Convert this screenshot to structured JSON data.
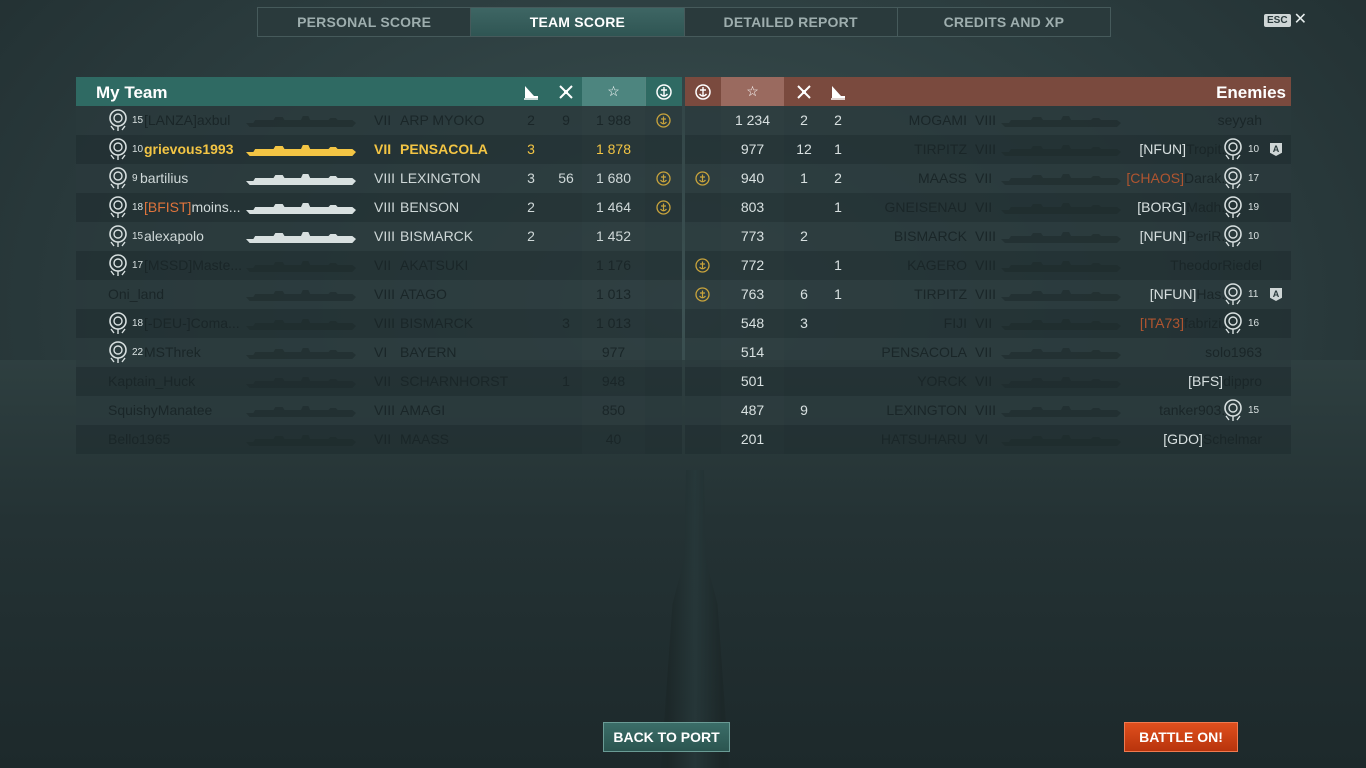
{
  "tabs": [
    {
      "label": "PERSONAL SCORE",
      "active": false
    },
    {
      "label": "TEAM SCORE",
      "active": true
    },
    {
      "label": "DETAILED REPORT",
      "active": false
    },
    {
      "label": "CREDITS AND XP",
      "active": false
    }
  ],
  "close": {
    "key_label": "ESC",
    "icon": "close-icon"
  },
  "my_team": {
    "title": "My Team",
    "header_icons": [
      "ship-destroyed-icon",
      "planes-destroyed-icon",
      "base-xp-star-icon",
      "achievement-icon"
    ],
    "rows": [
      {
        "rank": "15",
        "clan": "[LANZA]",
        "clan_orange": false,
        "name": "axbul",
        "tier": "VII",
        "ship": "ARP MYOKO",
        "kills": "2",
        "planes": "9",
        "xp": "1 988",
        "achievement": true,
        "state": "dead"
      },
      {
        "rank": "10",
        "clan": "",
        "clan_orange": false,
        "name": "grievous1993",
        "tier": "VII",
        "ship": "PENSACOLA",
        "kills": "3",
        "planes": "",
        "xp": "1 878",
        "achievement": false,
        "state": "me"
      },
      {
        "rank": "9",
        "clan": "",
        "clan_orange": false,
        "name": "bartilius",
        "tier": "VIII",
        "ship": "LEXINGTON",
        "kills": "3",
        "planes": "56",
        "xp": "1 680",
        "achievement": true,
        "state": "alive"
      },
      {
        "rank": "18",
        "clan": "[BFIST]",
        "clan_orange": true,
        "name": "moins...",
        "tier": "VIII",
        "ship": "BENSON",
        "kills": "2",
        "planes": "",
        "xp": "1 464",
        "achievement": true,
        "state": "alive"
      },
      {
        "rank": "15",
        "clan": "",
        "clan_orange": false,
        "name": "alexapolo",
        "tier": "VIII",
        "ship": "BISMARCK",
        "kills": "2",
        "planes": "",
        "xp": "1 452",
        "achievement": false,
        "state": "alive"
      },
      {
        "rank": "17",
        "clan": "[MSSD]",
        "clan_orange": false,
        "name": "Maste...",
        "tier": "VII",
        "ship": "AKATSUKI",
        "kills": "",
        "planes": "",
        "xp": "1 176",
        "achievement": false,
        "state": "dead"
      },
      {
        "rank": "",
        "clan": "",
        "clan_orange": false,
        "name": "Oni_land",
        "tier": "VIII",
        "ship": "ATAGO",
        "kills": "",
        "planes": "",
        "xp": "1 013",
        "achievement": false,
        "state": "dead"
      },
      {
        "rank": "18",
        "clan": "[-DEU-]",
        "clan_orange": false,
        "name": "Coma...",
        "tier": "VIII",
        "ship": "BISMARCK",
        "kills": "",
        "planes": "3",
        "xp": "1 013",
        "achievement": false,
        "state": "dead"
      },
      {
        "rank": "22",
        "clan": "",
        "clan_orange": false,
        "name": "MSThrek",
        "tier": "VI",
        "ship": "BAYERN",
        "kills": "",
        "planes": "",
        "xp": "977",
        "achievement": false,
        "state": "dead"
      },
      {
        "rank": "",
        "clan": "",
        "clan_orange": false,
        "name": "Kaptain_Huck",
        "tier": "VII",
        "ship": "SCHARNHORST",
        "kills": "",
        "planes": "1",
        "xp": "948",
        "achievement": false,
        "state": "dead"
      },
      {
        "rank": "",
        "clan": "",
        "clan_orange": false,
        "name": "SquishyManatee",
        "tier": "VIII",
        "ship": "AMAGI",
        "kills": "",
        "planes": "",
        "xp": "850",
        "achievement": false,
        "state": "dead"
      },
      {
        "rank": "",
        "clan": "",
        "clan_orange": false,
        "name": "Bello1965",
        "tier": "VII",
        "ship": "MAASS",
        "kills": "",
        "planes": "",
        "xp": "40",
        "achievement": false,
        "state": "dead"
      }
    ]
  },
  "enemies": {
    "title": "Enemies",
    "header_icons": [
      "achievement-icon",
      "base-xp-star-icon",
      "planes-destroyed-icon",
      "ship-destroyed-icon"
    ],
    "rows": [
      {
        "achievement": false,
        "xp": "1 234",
        "planes": "2",
        "kills": "2",
        "ship": "MOGAMI",
        "tier": "VIII",
        "clan": "",
        "clan_orange": false,
        "name": "seyyah",
        "rank": "",
        "division": "",
        "state": "dead"
      },
      {
        "achievement": false,
        "xp": "977",
        "planes": "12",
        "kills": "1",
        "ship": "TIRPITZ",
        "tier": "VIII",
        "clan": "[NFUN]",
        "clan_orange": false,
        "name": "Tropit...",
        "rank": "10",
        "division": "A",
        "state": "dead"
      },
      {
        "achievement": true,
        "xp": "940",
        "planes": "1",
        "kills": "2",
        "ship": "MAASS",
        "tier": "VII",
        "clan": "[CHAOS]",
        "clan_orange": true,
        "name": "Darak...",
        "rank": "17",
        "division": "",
        "state": "dead"
      },
      {
        "achievement": false,
        "xp": "803",
        "planes": "",
        "kills": "1",
        "ship": "GNEISENAU",
        "tier": "VII",
        "clan": "[BORG]",
        "clan_orange": false,
        "name": "Madh...",
        "rank": "19",
        "division": "",
        "state": "dead"
      },
      {
        "achievement": false,
        "xp": "773",
        "planes": "2",
        "kills": "",
        "ship": "BISMARCK",
        "tier": "VIII",
        "clan": "[NFUN]",
        "clan_orange": false,
        "name": "PeriR...",
        "rank": "10",
        "division": "",
        "state": "dead"
      },
      {
        "achievement": true,
        "xp": "772",
        "planes": "",
        "kills": "1",
        "ship": "KAGERO",
        "tier": "VIII",
        "clan": "",
        "clan_orange": false,
        "name": "TheodorRiedel",
        "rank": "",
        "division": "",
        "state": "dead"
      },
      {
        "achievement": true,
        "xp": "763",
        "planes": "6",
        "kills": "1",
        "ship": "TIRPITZ",
        "tier": "VIII",
        "clan": "[NFUN]",
        "clan_orange": false,
        "name": "Has...",
        "rank": "11",
        "division": "A",
        "state": "dead"
      },
      {
        "achievement": false,
        "xp": "548",
        "planes": "3",
        "kills": "",
        "ship": "FIJI",
        "tier": "VII",
        "clan": "[ITA73]",
        "clan_orange": true,
        "name": "fabrizi...",
        "rank": "16",
        "division": "",
        "state": "dead"
      },
      {
        "achievement": false,
        "xp": "514",
        "planes": "",
        "kills": "",
        "ship": "PENSACOLA",
        "tier": "VII",
        "clan": "",
        "clan_orange": false,
        "name": "solo1963",
        "rank": "",
        "division": "",
        "state": "dead"
      },
      {
        "achievement": false,
        "xp": "501",
        "planes": "",
        "kills": "",
        "ship": "YORCK",
        "tier": "VII",
        "clan": "[BFS]",
        "clan_orange": false,
        "name": "dippro",
        "rank": "",
        "division": "",
        "state": "dead"
      },
      {
        "achievement": false,
        "xp": "487",
        "planes": "9",
        "kills": "",
        "ship": "LEXINGTON",
        "tier": "VIII",
        "clan": "",
        "clan_orange": false,
        "name": "tanker903...",
        "rank": "15",
        "division": "",
        "state": "dead"
      },
      {
        "achievement": false,
        "xp": "201",
        "planes": "",
        "kills": "",
        "ship": "HATSUHARU",
        "tier": "VI",
        "clan": "[GDO]",
        "clan_orange": false,
        "name": "Schelmar",
        "rank": "",
        "division": "",
        "state": "dead"
      }
    ]
  },
  "buttons": {
    "back_to_port": "BACK TO PORT",
    "battle_on": "BATTLE ON!"
  },
  "colors": {
    "my_team_header": "#2f6a63",
    "enemy_header": "#7a4a3e",
    "me_highlight": "#f3c544",
    "clan_orange": "#e0743c",
    "battle_button": "#d2451a"
  }
}
